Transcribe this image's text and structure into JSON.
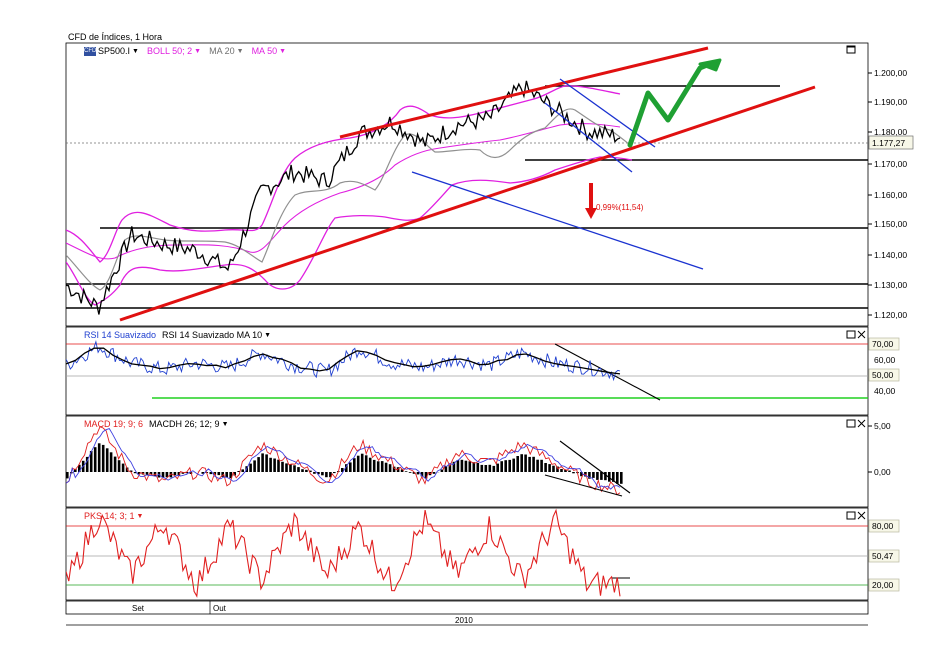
{
  "window_title": "CFD de Índices, 1 Hora",
  "price_panel": {
    "symbol": "SP500.I",
    "indicators": [
      {
        "label": "BOLL 50; 2",
        "color": "#e020e0"
      },
      {
        "label": "MA 20",
        "color": "#909090"
      },
      {
        "label": "MA 50",
        "color": "#e020e0"
      }
    ],
    "axis_ticks": [
      "1.200,00",
      "1.190,00",
      "1.180,00",
      "1.170,00",
      "1.160,00",
      "1.150,00",
      "1.140,00",
      "1.130,00",
      "1.120,00"
    ],
    "last_price": "1.177,27",
    "annotation": "0,99%(11,54)"
  },
  "rsi_panel": {
    "labels": [
      {
        "text": "RSI 14 Suavizado",
        "color": "#2040d0"
      },
      {
        "text": "RSI 14 Suavizado MA 10",
        "color": "#000000"
      }
    ],
    "axis_ticks": [
      "70,00",
      "60,00",
      "50,00",
      "40,00"
    ]
  },
  "macd_panel": {
    "labels": [
      {
        "text": "MACD 19; 9; 6",
        "color": "#e02020"
      },
      {
        "text": "MACDH 26; 12; 9",
        "color": "#000000"
      }
    ],
    "axis_ticks": [
      "5,00",
      "0,00"
    ]
  },
  "pks_panel": {
    "labels": [
      {
        "text": "PKS 14; 3; 1",
        "color": "#e02020"
      }
    ],
    "axis_ticks": [
      "80,00",
      "50,47",
      "20,00"
    ]
  },
  "time_axis": {
    "months": [
      "Set",
      "Out"
    ],
    "year": "2010"
  },
  "colors": {
    "trend_red": "#e01010",
    "channel_blue": "#1a32d0",
    "arrow_green": "#1fa033",
    "bollinger": "#e020e0",
    "ma20": "#909090",
    "rsi": "#2040d0",
    "pks": "#e02020",
    "level_green": "#20d020"
  },
  "chart_data": {
    "type": "line",
    "title": "CFD de Índices, 1 Hora",
    "symbol": "SP500.I",
    "series": [
      {
        "name": "SP500.I",
        "x": [
          "Set",
          "",
          "",
          "",
          "Out",
          "",
          "",
          "",
          "",
          "",
          "",
          "",
          "",
          "",
          "",
          "",
          "",
          "2010"
        ],
        "values": [
          1130,
          1123,
          1146,
          1143,
          1141,
          1135,
          1160,
          1166,
          1163,
          1178,
          1182,
          1175,
          1181,
          1183,
          1193,
          1186,
          1179,
          1177.27
        ]
      },
      {
        "name": "RSI 14 Suavizado",
        "values": [
          50,
          68,
          52,
          46,
          52,
          48,
          62,
          50,
          44,
          66,
          52,
          48,
          56,
          50,
          62,
          52,
          48,
          42
        ]
      },
      {
        "name": "MACD 19; 9; 6",
        "values": [
          -1,
          5,
          0,
          -1,
          0,
          -1,
          3,
          1,
          -1,
          3,
          1,
          -1,
          2,
          1,
          3,
          1,
          -1,
          -2
        ]
      },
      {
        "name": "PKS 14; 3; 1",
        "values": [
          20,
          90,
          30,
          85,
          20,
          80,
          25,
          85,
          30,
          80,
          20,
          85,
          30,
          80,
          25,
          85,
          20,
          22
        ]
      }
    ],
    "ylim": [
      1117,
      1207
    ],
    "y_ticks": [
      1120,
      1130,
      1140,
      1150,
      1160,
      1170,
      1180,
      1190,
      1200
    ],
    "horizontal_levels": [
      1122.5,
      1131,
      1149.5,
      1171,
      1196
    ],
    "last_value": 1177.27,
    "annotations": [
      "0,99%(11,54)"
    ],
    "grid": false
  }
}
